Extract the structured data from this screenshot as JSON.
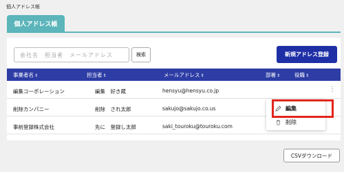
{
  "breadcrumb": "個人アドレス帳",
  "tab_label": "個人アドレス帳",
  "search": {
    "placeholder": "会社名　担当者　メールアドレス",
    "button_label": "検索"
  },
  "new_button_label": "新規アドレス登録",
  "columns": [
    {
      "label": "事業者名"
    },
    {
      "label": "担当者"
    },
    {
      "label": "メールアドレス"
    },
    {
      "label": "部署"
    },
    {
      "label": "役職"
    }
  ],
  "sort_glyph": "⇕",
  "rows": [
    {
      "company": "編集コーポレーション",
      "person": "編集　好き蔵",
      "email": "hensyu@hensyu.co.jp"
    },
    {
      "company": "削除カンパニー",
      "person": "削除　され太郎",
      "email": "sakujo@sakujo.co.us"
    },
    {
      "company": "事前登録株式会社",
      "person": "先に　登録し太郎",
      "email": "saki_touroku@touroku.com"
    }
  ],
  "menu": {
    "edit_label": "編集",
    "delete_label": "削除"
  },
  "csv_button_label": "CSVダウンロード",
  "colors": {
    "tab": "#5bb5ba",
    "header": "#2d3da5",
    "primary_button": "#1f2fa6",
    "highlight": "#e3241b"
  }
}
